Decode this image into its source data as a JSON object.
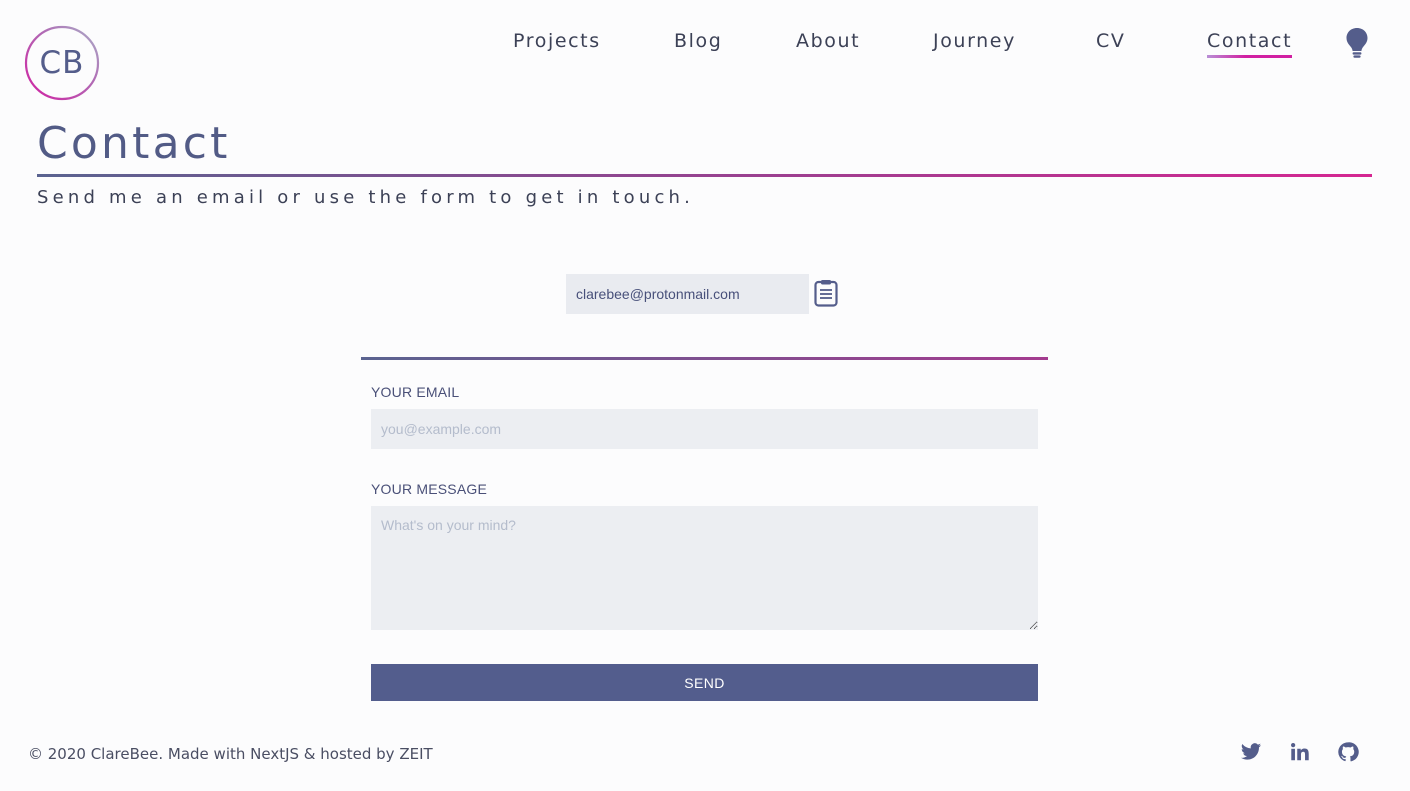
{
  "brand": {
    "logo_text": "CB"
  },
  "nav": {
    "items": [
      {
        "label": "Projects"
      },
      {
        "label": "Blog"
      },
      {
        "label": "About"
      },
      {
        "label": "Journey"
      },
      {
        "label": "CV"
      },
      {
        "label": "Contact",
        "active": true
      }
    ],
    "theme_toggle_icon": "lightbulb-icon"
  },
  "page": {
    "title": "Contact",
    "subtitle": "Send me an email or use the form to get in touch."
  },
  "email_copy": {
    "value": "clarebee@protonmail.com",
    "copy_icon": "clipboard-icon"
  },
  "form": {
    "email_label": "YOUR EMAIL",
    "email_placeholder": "you@example.com",
    "message_label": "YOUR MESSAGE",
    "message_placeholder": "What's on your mind?",
    "send_label": "SEND"
  },
  "footer": {
    "text": "© 2020 ClareBee. Made with NextJS & hosted by ZEIT",
    "social": [
      "twitter-icon",
      "linkedin-icon",
      "github-icon"
    ]
  },
  "colors": {
    "accent_primary": "#535d8d",
    "accent_pink": "#d11fa2",
    "input_background": "#eceef2",
    "page_background": "#fcfcfd"
  }
}
